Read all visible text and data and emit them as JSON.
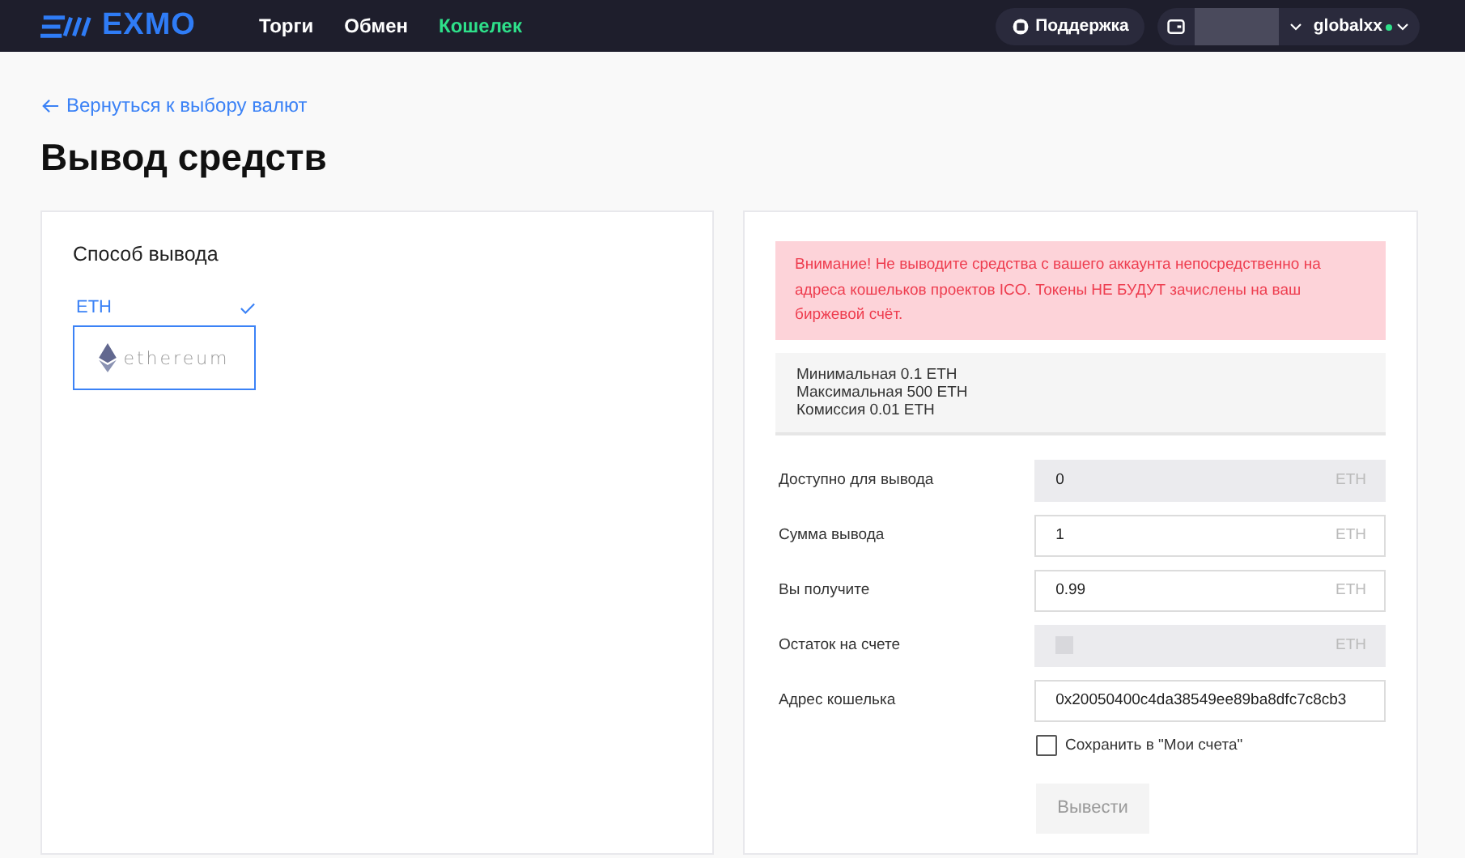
{
  "header": {
    "logo": "EXMO",
    "nav": [
      {
        "label": "Торги",
        "selected": false
      },
      {
        "label": "Обмен",
        "selected": false
      },
      {
        "label": "Кошелек",
        "selected": true
      }
    ],
    "support": "Поддержка",
    "user": {
      "name": "globalxx",
      "online": true
    }
  },
  "back_link": "Вернуться к выбору валют",
  "title": "Вывод средств",
  "method_panel": {
    "heading": "Способ вывода",
    "methods": [
      {
        "label": "ETH",
        "selected": true,
        "logo_text": "ethereum"
      }
    ]
  },
  "warning": "Внимание! Не выводите средства с вашего аккаунта непосредственно на адреса кошельков проектов ICO. Токены НЕ БУДУТ зачислены на ваш биржевой счёт.",
  "limits": [
    "Минимальная 0.1 ETH",
    "Максимальная 500 ETH",
    "Комиссия 0.01 ETH"
  ],
  "fields": [
    {
      "label": "Доступно для вывода",
      "value": "0",
      "unit": "ETH",
      "disabled": true,
      "kind": "amount"
    },
    {
      "label": "Сумма вывода",
      "value": "1",
      "unit": "ETH",
      "disabled": false,
      "kind": "amount"
    },
    {
      "label": "Вы получите",
      "value": "0.99",
      "unit": "ETH",
      "disabled": false,
      "kind": "amount"
    },
    {
      "label": "Остаток на счете",
      "unit": "ETH",
      "disabled": true,
      "kind": "hidden"
    },
    {
      "label": "Адрес кошелька",
      "value": "0x20050400c4da38549ee89ba8dfc7c8cb3",
      "disabled": false,
      "kind": "text"
    }
  ],
  "save_checkbox": {
    "label": "Сохранить в \"Мои счета\"",
    "checked": false
  },
  "submit": {
    "label": "Вывести",
    "disabled": true
  }
}
